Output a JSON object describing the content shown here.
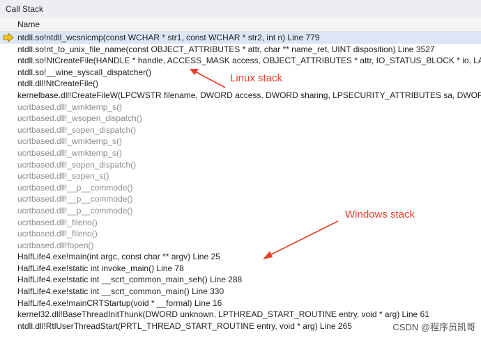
{
  "window": {
    "title": "Call Stack"
  },
  "column": {
    "name": "Name"
  },
  "frames": [
    {
      "text": "ntdll.so!ntdll_wcsnicmp(const WCHAR * str1, const WCHAR * str2, int n) Line 779",
      "ext": false,
      "current": true
    },
    {
      "text": "ntdll.so!nt_to_unix_file_name(const OBJECT_ATTRIBUTES * attr, char ** name_ret, UINT disposition) Line 3527",
      "ext": false,
      "current": false
    },
    {
      "text": "ntdll.so!NtCreateFile(HANDLE * handle, ACCESS_MASK access, OBJECT_ATTRIBUTES * attr, IO_STATUS_BLOCK * io, LARGE_INTEGER * alloc_size, ULONG attributes, ULONG sharing, ULONG disposition)",
      "ext": false,
      "current": false
    },
    {
      "text": "ntdll.so!__wine_syscall_dispatcher()",
      "ext": false,
      "current": false
    },
    {
      "text": "ntdll.dll!NtCreateFile()",
      "ext": false,
      "current": false
    },
    {
      "text": "kernelbase.dll!CreateFileW(LPCWSTR filename, DWORD access, DWORD sharing, LPSECURITY_ATTRIBUTES sa, DWORD creation, DWORD attributes)",
      "ext": false,
      "current": false
    },
    {
      "text": "ucrtbased.dll!_wmktemp_s()",
      "ext": true,
      "current": false
    },
    {
      "text": "ucrtbased.dll!_wsopen_dispatch()",
      "ext": true,
      "current": false
    },
    {
      "text": "ucrtbased.dll!_sopen_dispatch()",
      "ext": true,
      "current": false
    },
    {
      "text": "ucrtbased.dll!_wmktemp_s()",
      "ext": true,
      "current": false
    },
    {
      "text": "ucrtbased.dll!_wmktemp_s()",
      "ext": true,
      "current": false
    },
    {
      "text": "ucrtbased.dll!_sopen_dispatch()",
      "ext": true,
      "current": false
    },
    {
      "text": "ucrtbased.dll!_sopen_s()",
      "ext": true,
      "current": false
    },
    {
      "text": "ucrtbased.dll!__p__commode()",
      "ext": true,
      "current": false
    },
    {
      "text": "ucrtbased.dll!__p__commode()",
      "ext": true,
      "current": false
    },
    {
      "text": "ucrtbased.dll!__p__commode()",
      "ext": true,
      "current": false
    },
    {
      "text": "ucrtbased.dll!_fileno()",
      "ext": true,
      "current": false
    },
    {
      "text": "ucrtbased.dll!_fileno()",
      "ext": true,
      "current": false
    },
    {
      "text": "ucrtbased.dll!fopen()",
      "ext": true,
      "current": false
    },
    {
      "text": "HalfLife4.exe!main(int argc, const char ** argv) Line 25",
      "ext": false,
      "current": false
    },
    {
      "text": "HalfLife4.exe!static int invoke_main() Line 78",
      "ext": false,
      "current": false
    },
    {
      "text": "HalfLife4.exe!static int __scrt_common_main_seh() Line 288",
      "ext": false,
      "current": false
    },
    {
      "text": "HalfLife4.exe!static int __scrt_common_main() Line 330",
      "ext": false,
      "current": false
    },
    {
      "text": "HalfLife4.exe!mainCRTStartup(void * __formal) Line 16",
      "ext": false,
      "current": false
    },
    {
      "text": "kernel32.dll!BaseThreadInitThunk(DWORD unknown, LPTHREAD_START_ROUTINE entry, void * arg) Line 61",
      "ext": false,
      "current": false
    },
    {
      "text": "ntdll.dll!RtlUserThreadStart(PRTL_THREAD_START_ROUTINE entry, void * arg) Line 265",
      "ext": false,
      "current": false
    }
  ],
  "annotations": {
    "linux": "Linux stack",
    "windows": "Windows stack",
    "color": "#e8412c"
  },
  "watermark": "CSDN @程序员凯哥",
  "icons": {
    "current_frame": "current-frame-arrow-icon"
  },
  "colors": {
    "current_row": "#dde6f5",
    "external_text": "#8c8c8c",
    "arrow_fill": "#f0c419"
  }
}
